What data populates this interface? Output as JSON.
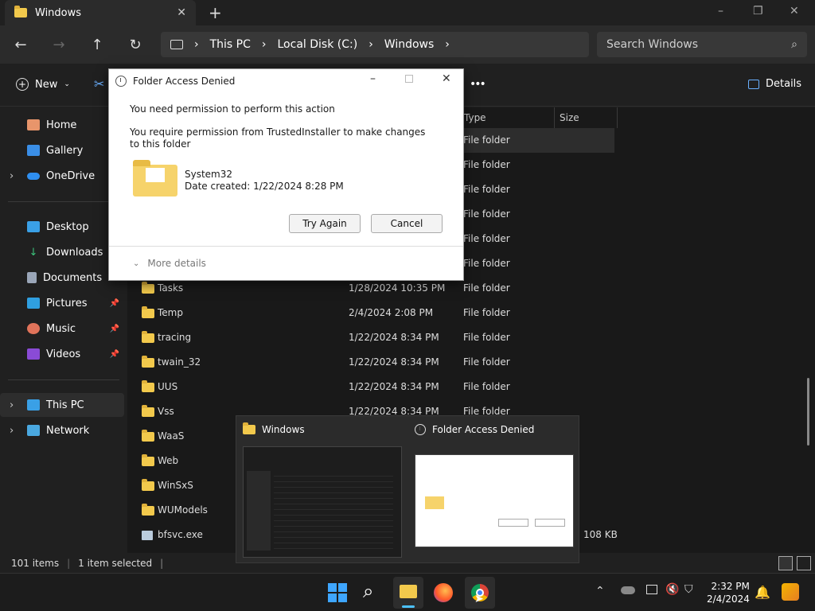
{
  "window": {
    "tab_title": "Windows",
    "new_tab": "+",
    "minimize": "–",
    "maximize": "❐",
    "close": "✕"
  },
  "nav": {
    "back": "←",
    "forward": "→",
    "up": "↑",
    "refresh": "↻",
    "breadcrumb": [
      "This PC",
      "Local Disk (C:)",
      "Windows"
    ],
    "search_placeholder": "Search Windows"
  },
  "toolbar": {
    "new_label": "New",
    "more": "•••",
    "details_label": "Details"
  },
  "sidebar": {
    "items": [
      {
        "label": "Home"
      },
      {
        "label": "Gallery"
      },
      {
        "label": "OneDrive"
      },
      {
        "label": "Desktop"
      },
      {
        "label": "Downloads"
      },
      {
        "label": "Documents"
      },
      {
        "label": "Pictures"
      },
      {
        "label": "Music"
      },
      {
        "label": "Videos"
      },
      {
        "label": "This PC"
      },
      {
        "label": "Network"
      }
    ]
  },
  "filelist": {
    "columns": {
      "type": "Type",
      "size": "Size"
    },
    "top_rows": [
      {
        "type": "File folder"
      },
      {
        "type": "File folder"
      },
      {
        "type": "File folder"
      },
      {
        "type": "File folder"
      },
      {
        "type": "File folder"
      },
      {
        "type": "File folder"
      }
    ],
    "rows": [
      {
        "name": "Tasks",
        "date": "1/28/2024 10:35 PM",
        "type": "File folder",
        "size": ""
      },
      {
        "name": "Temp",
        "date": "2/4/2024 2:08 PM",
        "type": "File folder",
        "size": ""
      },
      {
        "name": "tracing",
        "date": "1/22/2024 8:34 PM",
        "type": "File folder",
        "size": ""
      },
      {
        "name": "twain_32",
        "date": "1/22/2024 8:34 PM",
        "type": "File folder",
        "size": ""
      },
      {
        "name": "UUS",
        "date": "1/22/2024 8:34 PM",
        "type": "File folder",
        "size": ""
      },
      {
        "name": "Vss",
        "date": "1/22/2024 8:34 PM",
        "type": "File folder",
        "size": ""
      },
      {
        "name": "WaaS",
        "date": "",
        "type": "",
        "size": ""
      },
      {
        "name": "Web",
        "date": "",
        "type": "",
        "size": ""
      },
      {
        "name": "WinSxS",
        "date": "",
        "type": "",
        "size": ""
      },
      {
        "name": "WUModels",
        "date": "",
        "type": "",
        "size": ""
      },
      {
        "name": "bfsvc.exe",
        "date": "",
        "type": "",
        "size": "108 KB"
      }
    ]
  },
  "status": {
    "items": "101 items",
    "selected": "1 item selected"
  },
  "dialog": {
    "title": "Folder Access Denied",
    "heading": "You need permission to perform this action",
    "message": "You require permission from TrustedInstaller to make changes to this folder",
    "folder_name": "System32",
    "date_created": "Date created: 1/22/2024 8:28 PM",
    "try_again": "Try Again",
    "cancel": "Cancel",
    "more_details": "More details"
  },
  "previews": {
    "explorer_title": "Windows",
    "dialog_title": "Folder Access Denied"
  },
  "taskbar": {
    "time": "2:32 PM",
    "date": "2/4/2024"
  },
  "colors": {
    "accent": "#4cc2ff",
    "folder": "#f2c94c",
    "dialog_bg": "#ffffff"
  }
}
